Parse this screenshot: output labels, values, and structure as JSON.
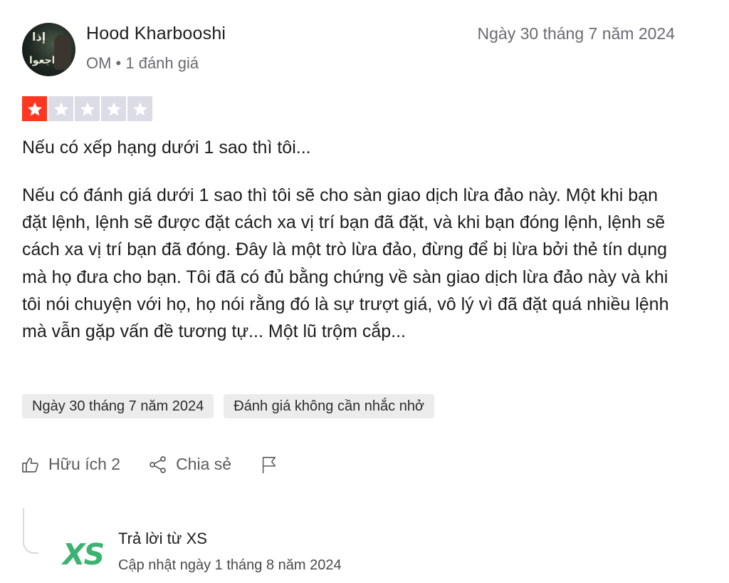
{
  "reviewer": {
    "name": "Hood Kharbooshi",
    "meta": "OM • 1 đánh giá",
    "date": "Ngày 30 tháng 7 năm 2024",
    "avatar_text_top": "إذا",
    "avatar_text_bottom": "راجعوا"
  },
  "rating": {
    "value": 1,
    "max": 5
  },
  "review": {
    "title": "Nếu có xếp hạng dưới 1 sao thì tôi...",
    "body": "Nếu có đánh giá dưới 1 sao thì tôi sẽ cho sàn giao dịch lừa đảo này. Một khi bạn đặt lệnh, lệnh sẽ được đặt cách xa vị trí bạn đã đặt, và khi bạn đóng lệnh, lệnh sẽ cách xa vị trí bạn đã đóng. Đây là một trò lừa đảo, đừng để bị lừa bởi thẻ tín dụng mà họ đưa cho bạn. Tôi đã có đủ bằng chứng về sàn giao dịch lừa đảo này và khi tôi nói chuyện với họ, họ nói rằng đó là sự trượt giá, vô lý vì đã đặt quá nhiều lệnh mà vẫn gặp vấn đề tương tự... Một lũ trộm cắp..."
  },
  "tags": {
    "date": "Ngày 30 tháng 7 năm 2024",
    "unprompted": "Đánh giá không cần nhắc nhở"
  },
  "actions": {
    "useful_label": "Hữu ích 2",
    "share_label": "Chia sẻ"
  },
  "reply": {
    "logo_text": "XS",
    "title": "Trả lời từ XS",
    "date": "Cập nhật ngày 1 tháng 8 năm 2024"
  },
  "colors": {
    "star_filled": "#ff3722",
    "star_empty": "#dcdce6",
    "logo": "#3cb371"
  },
  "icons": [
    "thumbs-up-icon",
    "share-icon",
    "flag-icon",
    "star-icon"
  ]
}
